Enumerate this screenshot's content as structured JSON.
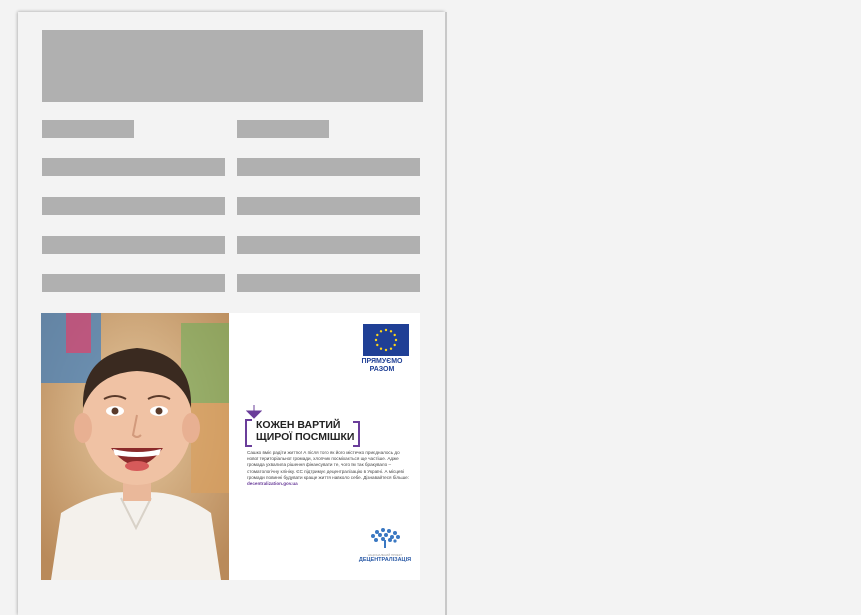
{
  "ad": {
    "eu_flag_icon": "eu-flag-icon",
    "slogan_line1": "ПРЯМУЄМО",
    "slogan_line2": "РАЗОМ",
    "headline_line1": "КОЖЕН ВАРТИЙ",
    "headline_line2": "ЩИРОЇ ПОСМІШКИ",
    "body": "Сашко вміє радіти життю! А після того як його містечко приєдналось до нової територіальної громади, хлопчик посміхається ще частіше. Адже громада ухвалила рішення фінансувати те, чого їм так бракувало – стоматологічну клініку. ЄС підтримує децентралізацію в Україні. А місцеві громади повинні будувати краще життя навколо себе. Дізнавайтеся більше: ",
    "link": "decentralization.gov.ua",
    "logo_small": "НАЦІОНАЛЬНИЙ ПРОЕКТ",
    "logo_name": "ДЕЦЕНТРАЛІЗАЦІЯ",
    "accent_color": "#6a3d9a",
    "eu_blue": "#1f3f95"
  }
}
